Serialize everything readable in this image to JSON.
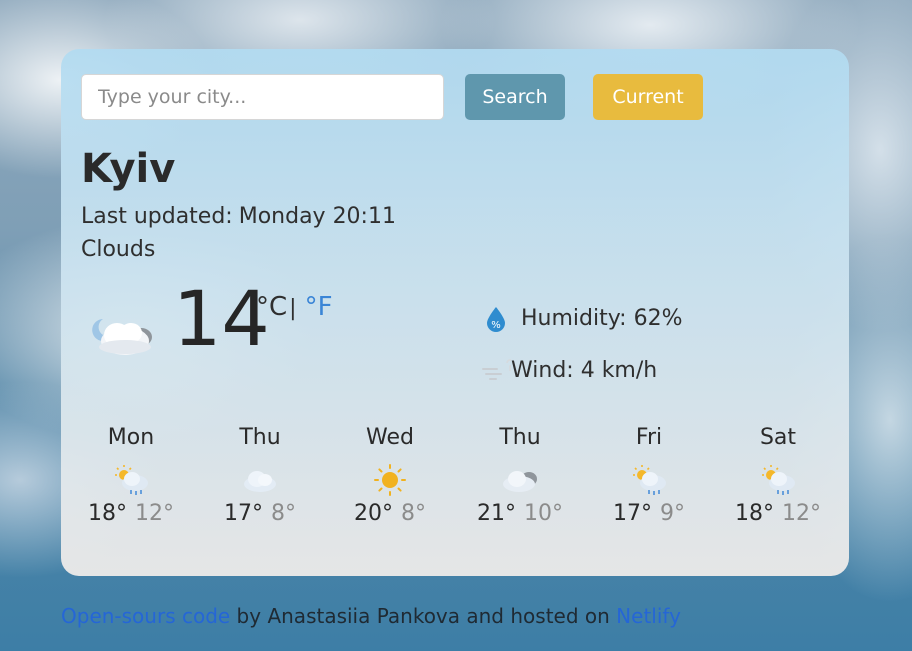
{
  "search": {
    "placeholder": "Type your city...",
    "value": "",
    "search_label": "Search",
    "current_label": "Current"
  },
  "weather": {
    "city": "Kyiv",
    "updated_label": "Last updated:",
    "updated_value": "Monday 20:11",
    "description": "Clouds",
    "temperature": "14",
    "unit_celsius": "°C",
    "unit_separator": "|",
    "unit_fahrenheit": "°F",
    "humidity_label": "Humidity:",
    "humidity_value": "62%",
    "wind_label": "Wind:",
    "wind_value": "4 km/h",
    "main_icon": "cloud-night-icon"
  },
  "forecast": [
    {
      "day": "Mon",
      "max": "18°",
      "min": "12°",
      "icon": "sun-rain-icon"
    },
    {
      "day": "Thu",
      "max": "17°",
      "min": "8°",
      "icon": "cloud-icon"
    },
    {
      "day": "Wed",
      "max": "20°",
      "min": "8°",
      "icon": "sun-icon"
    },
    {
      "day": "Thu",
      "max": "21°",
      "min": "10°",
      "icon": "clouds-icon"
    },
    {
      "day": "Fri",
      "max": "17°",
      "min": "9°",
      "icon": "sun-rain-icon"
    },
    {
      "day": "Sat",
      "max": "18°",
      "min": "12°",
      "icon": "sun-rain-icon"
    }
  ],
  "footer": {
    "source_link": "Open-sours code",
    "text": " by Anastasiia Pankova and hosted on ",
    "host_link": "Netlify"
  },
  "colors": {
    "search_button": "#5f97ad",
    "current_button": "#e8bb3e",
    "link": "#2566d6",
    "fahrenheit": "#3a85d6"
  }
}
